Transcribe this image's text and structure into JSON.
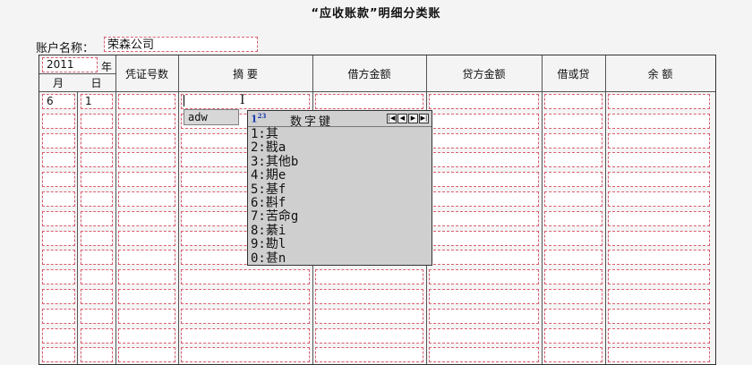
{
  "title": "“应收账款”明细分类账",
  "account": {
    "label": "账户名称：",
    "value": "荣森公司"
  },
  "header": {
    "year_value": "2011",
    "year_label": "年",
    "month_label": "月",
    "day_label": "日",
    "voucher_label": "凭证号数",
    "summary_label": "摘 要",
    "debit_label": "借方金额",
    "credit_label": "贷方金额",
    "dc_label": "借或贷",
    "balance_label": "余 额"
  },
  "rows": [
    {
      "month": "6",
      "day": "1",
      "voucher": "",
      "summary": "",
      "debit": "",
      "credit": "",
      "dc": "",
      "balance": ""
    }
  ],
  "ime": {
    "composition": "adw",
    "logo": "1",
    "logo_sup": "23",
    "mode_label": "数字键",
    "candidates": [
      "1:其",
      "2:戡a",
      "3:其他b",
      "4:期e",
      "5:基f",
      "6:斟f",
      "7:苦命g",
      "8:綦i",
      "9:勘l",
      "0:甚n"
    ],
    "nav_icons": [
      "first-page-icon",
      "prev-page-icon",
      "next-page-icon",
      "last-page-icon"
    ]
  },
  "colors": {
    "cell_border": "#d85c6e",
    "grid": "#555555",
    "background": "#f4f4f4"
  }
}
